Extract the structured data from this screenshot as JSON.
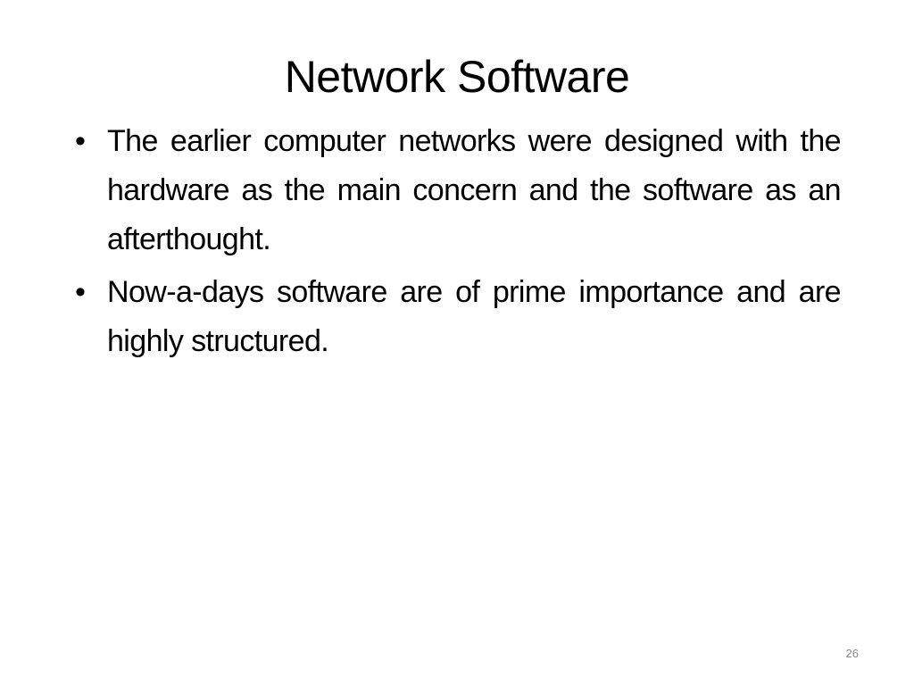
{
  "slide": {
    "title": "Network Software",
    "bullets": [
      {
        "marker": "•",
        "text": "The earlier computer networks were designed with the hardware as the main concern and the software as an afterthought."
      },
      {
        "marker": "•",
        "text": "Now-a-days software are of prime importance and are highly structured."
      }
    ],
    "page_number": "26"
  }
}
